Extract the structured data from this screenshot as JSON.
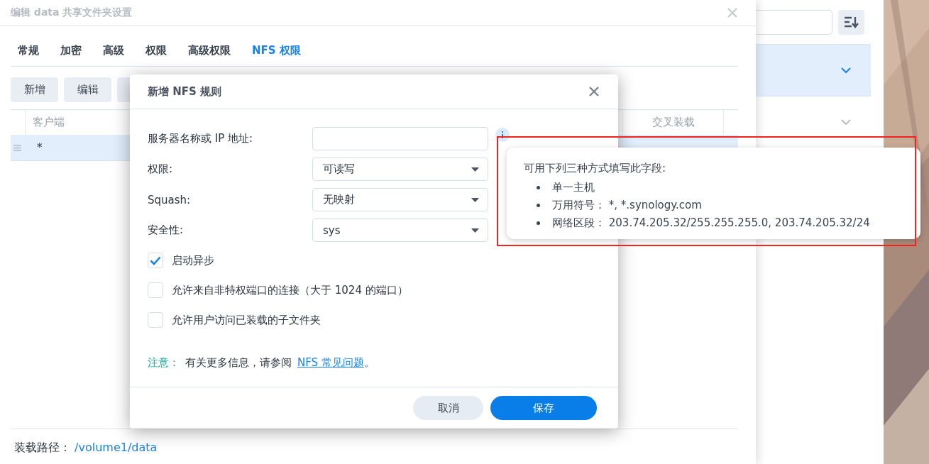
{
  "window": {
    "title": "编辑 data 共享文件夹设置"
  },
  "tabs": [
    {
      "label": "常规",
      "selected": false
    },
    {
      "label": "加密",
      "selected": false
    },
    {
      "label": "高级",
      "selected": false
    },
    {
      "label": "权限",
      "selected": false
    },
    {
      "label": "高级权限",
      "selected": false
    },
    {
      "label": "NFS 权限",
      "selected": true
    }
  ],
  "toolbar_buttons": [
    "新增",
    "编辑"
  ],
  "table": {
    "columns": [
      "客户端",
      "交叉装载"
    ],
    "rows": [
      {
        "client": "*",
        "selected": true
      }
    ]
  },
  "mount_path": {
    "label": "装载路径：",
    "value": "/volume1/data"
  },
  "side_panel": {
    "rows": [
      {
        "selected": true
      },
      {
        "selected": false
      }
    ]
  },
  "dialog": {
    "title": "新增 NFS 规则",
    "fields": [
      {
        "kind": "text",
        "label": "服务器名称或 IP 地址:",
        "info": true
      },
      {
        "kind": "select",
        "label": "权限:",
        "value": "可读写"
      },
      {
        "kind": "select",
        "label": "Squash:",
        "value": "无映射"
      },
      {
        "kind": "select",
        "label": "安全性:",
        "value": "sys"
      }
    ],
    "options": [
      {
        "label": "启动异步",
        "checked": true
      },
      {
        "label": "允许来自非特权端口的连接（大于 1024 的端口）",
        "checked": false
      },
      {
        "label": "允许用户访问已装载的子文件夹",
        "checked": false
      }
    ],
    "note": {
      "label": "注意：",
      "text": "有关更多信息，请参阅",
      "link": "NFS 常见问题",
      "end": "。"
    },
    "buttons": [
      {
        "label": "取消",
        "kind": "secondary"
      },
      {
        "label": "保存",
        "kind": "primary"
      }
    ]
  },
  "tooltip": {
    "intro": "可用下列三种方式填写此字段:",
    "items": [
      "单一主机",
      "万用符号：  *, *.synology.com",
      "网络区段：  203.74.205.32/255.255.255.0, 203.74.205.32/24"
    ]
  }
}
